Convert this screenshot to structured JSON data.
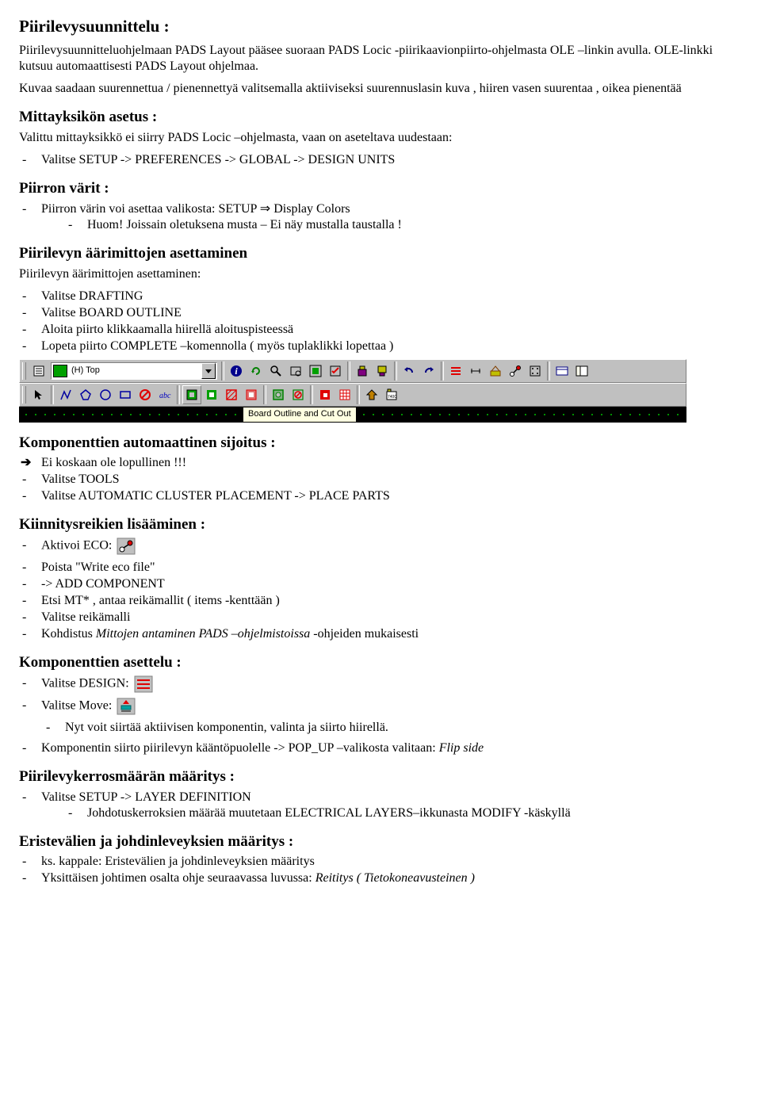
{
  "h1": "Piirilevysuunnittelu :",
  "intro_p1": "Piirilevysuunnitteluohjelmaan PADS Layout pääsee suoraan PADS Locic -piirikaavionpiirto-ohjelmasta OLE –linkin avulla. OLE-linkki kutsuu automaattisesti PADS Layout ohjelmaa.",
  "intro_p2": "Kuvaa saadaan suurennettua / pienennettyä valitsemalla aktiiviseksi suurennuslasin kuva , hiiren vasen suurentaa , oikea pienentää",
  "s_units_h": "Mittayksikön asetus :",
  "s_units_p": "Valittu mittayksikkö ei siirry PADS Locic –ohjelmasta, vaan on aseteltava uudestaan:",
  "s_units_li1": "Valitse SETUP -> PREFERENCES -> GLOBAL -> DESIGN UNITS",
  "s_colors_h": "Piirron värit :",
  "s_colors_li1": "Piirron värin voi asettaa valikosta: SETUP ⇒ Display Colors",
  "s_colors_li1a": "Huom! Joissain oletuksena musta – Ei näy mustalla taustalla !",
  "s_outline_h": "Piirilevyn äärimittojen asettaminen",
  "s_outline_p": "Piirilevyn äärimittojen asettaminen:",
  "s_outline_li1": "Valitse DRAFTING",
  "s_outline_li2": "Valitse BOARD OUTLINE",
  "s_outline_li3": "Aloita piirto klikkaamalla hiirellä aloituspisteessä",
  "s_outline_li4": "Lopeta piirto COMPLETE –komennolla ( myös tuplaklikki lopettaa )",
  "toolbar": {
    "layer_label": "(H) Top",
    "tooltip": "Board Outline and Cut Out"
  },
  "s_auto_h": "Komponenttien automaattinen sijoitus :",
  "s_auto_li0": "Ei koskaan ole lopullinen !!!",
  "s_auto_li1": "Valitse TOOLS",
  "s_auto_li2": "Valitse AUTOMATIC CLUSTER PLACEMENT -> PLACE PARTS",
  "s_holes_h": "Kiinnitysreikien lisääminen :",
  "s_holes_li1": "Aktivoi ECO:",
  "s_holes_li2": "Poista \"Write eco file\"",
  "s_holes_li3": "-> ADD COMPONENT",
  "s_holes_li4": "Etsi MT* , antaa reikämallit ( items -kenttään )",
  "s_holes_li5": "Valitse reikämalli",
  "s_holes_li6_a": "Kohdistus ",
  "s_holes_li6_i": "Mittojen antaminen PADS –ohjelmistoissa",
  "s_holes_li6_b": "  -ohjeiden mukaisesti",
  "s_place_h": "Komponenttien asettelu :",
  "s_place_li1": "Valitse DESIGN:",
  "s_place_li2": "Valitse Move:",
  "s_place_li3": "Nyt voit siirtää aktiivisen komponentin, valinta ja siirto hiirellä.",
  "s_place_li4_a": "Komponentin siirto piirilevyn kääntöpuolelle -> POP_UP –valikosta valitaan: ",
  "s_place_li4_i": "Flip side",
  "s_layers_h": "Piirilevykerrosmäärän määritys :",
  "s_layers_li1": "Valitse SETUP -> LAYER DEFINITION",
  "s_layers_li1a": "Johdotuskerroksien määrää muutetaan ELECTRICAL LAYERS–ikkunasta MODIFY -käskyllä",
  "s_clear_h": "Eristevälien ja johdinleveyksien määritys :",
  "s_clear_li1": "ks. kappale: Eristevälien ja johdinleveyksien määritys",
  "s_clear_li2_a": "Yksittäisen johtimen osalta ohje seuraavassa luvussa: ",
  "s_clear_li2_i": "Reititys ( Tietokoneavusteinen )"
}
